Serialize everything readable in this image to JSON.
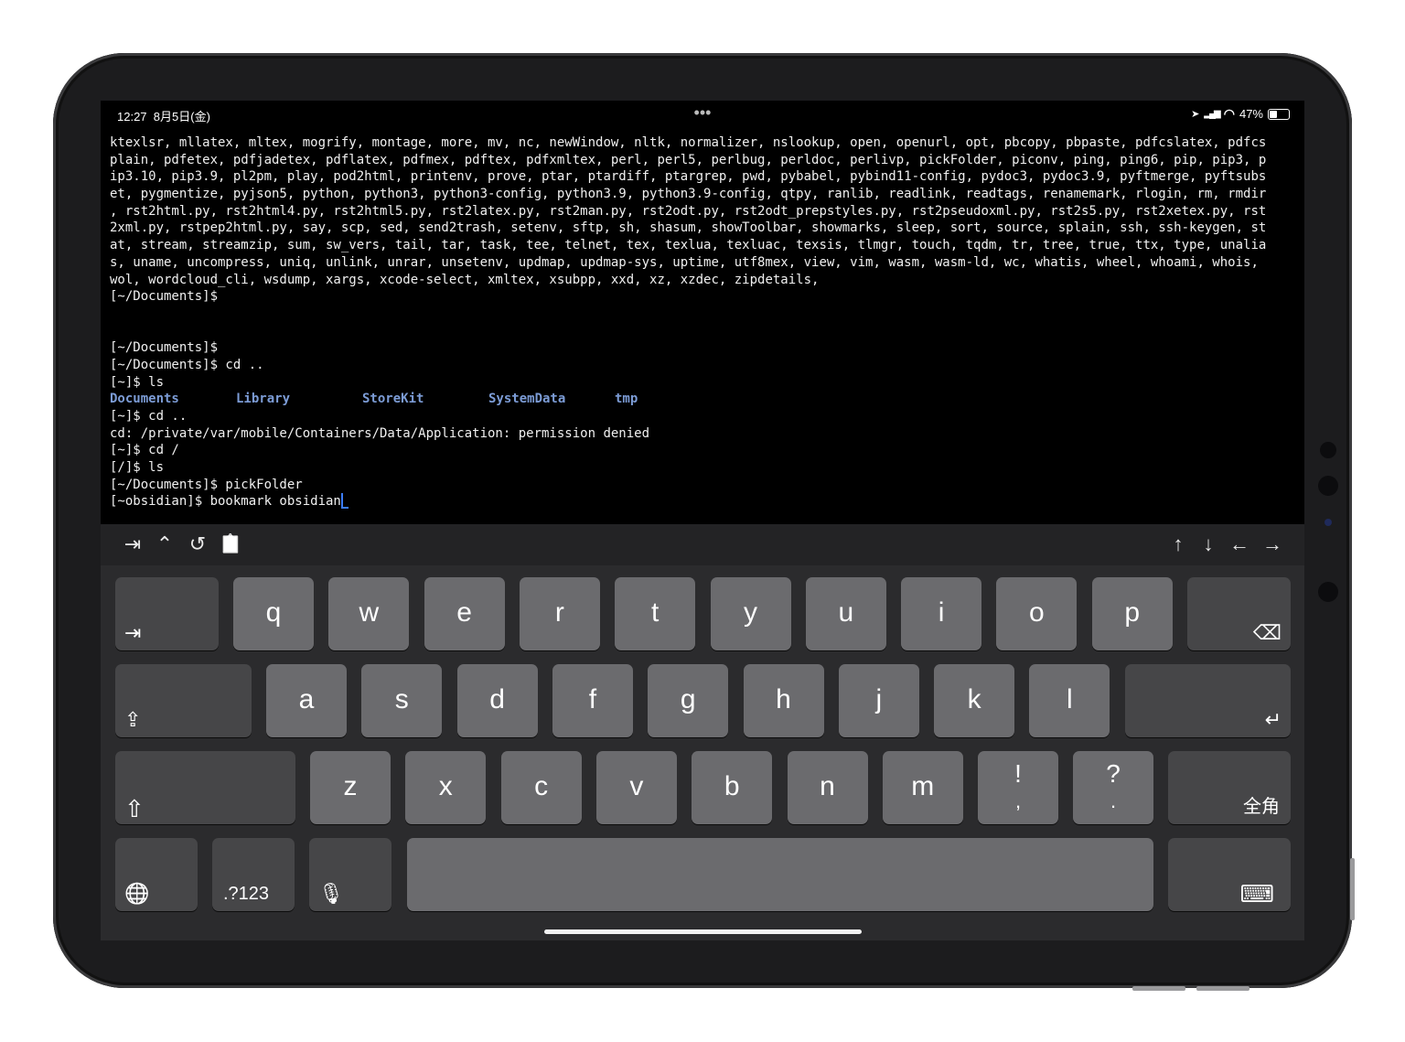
{
  "status_bar": {
    "time": "12:27",
    "date": "8月5日(金)",
    "dots": "•••",
    "location": "➤",
    "signal": "▂▄▆",
    "wifi": "◠",
    "battery": "47%"
  },
  "battery_level": 0.47,
  "terminal": {
    "lines": [
      "ktexlsr, mllatex, mltex, mogrify, montage, more, mv, nc, newWindow, nltk, normalizer, nslookup, open, openurl, opt, pbcopy, pbpaste, pdfcslatex, pdfcs",
      "plain, pdfetex, pdfjadetex, pdflatex, pdfmex, pdftex, pdfxmltex, perl, perl5, perlbug, perldoc, perlivp, pickFolder, piconv, ping, ping6, pip, pip3, p",
      "ip3.10, pip3.9, pl2pm, play, pod2html, printenv, prove, ptar, ptardiff, ptargrep, pwd, pybabel, pybind11-config, pydoc3, pydoc3.9, pyftmerge, pyftsubs",
      "et, pygmentize, pyjson5, python, python3, python3-config, python3.9, python3.9-config, qtpy, ranlib, readlink, readtags, renamemark, rlogin, rm, rmdir",
      ", rst2html.py, rst2html4.py, rst2html5.py, rst2latex.py, rst2man.py, rst2odt.py, rst2odt_prepstyles.py, rst2pseudoxml.py, rst2s5.py, rst2xetex.py, rst",
      "2xml.py, rstpep2html.py, say, scp, sed, send2trash, setenv, sftp, sh, shasum, showToolbar, showmarks, sleep, sort, source, splain, ssh, ssh-keygen, st",
      "at, stream, streamzip, sum, sw_vers, tail, tar, task, tee, telnet, tex, texlua, texluac, texsis, tlmgr, touch, tqdm, tr, tree, true, ttx, type, unalia",
      "s, uname, uncompress, uniq, unlink, unrar, unsetenv, updmap, updmap-sys, uptime, utf8mex, view, vim, wasm, wasm-ld, wc, whatis, wheel, whoami, whois,",
      "wol, wordcloud_cli, wsdump, xargs, xcode-select, xmltex, xsubpp, xxd, xz, xzdec, zipdetails,",
      "[~/Documents]$",
      "",
      "",
      "[~/Documents]$",
      "[~/Documents]$ cd ..",
      "[~]$ ls"
    ],
    "ls_dirs": [
      "Documents",
      "Library",
      "StoreKit",
      "SystemData",
      "tmp"
    ],
    "lines_after": [
      "[~]$ cd ..",
      "cd: /private/var/mobile/Containers/Data/Application: permission denied",
      "[~]$ cd /",
      "[/]$ ls",
      "[~/Documents]$ pickFolder"
    ],
    "current_line": "[~obsidian]$ bookmark obsidian"
  },
  "toolbar": {
    "left": [
      {
        "name": "tab-key-icon",
        "glyph": "⇥"
      },
      {
        "name": "control-key-icon",
        "glyph": "⌃"
      },
      {
        "name": "history-icon",
        "glyph": "↺"
      },
      {
        "name": "paste-icon",
        "glyph": "📋"
      }
    ],
    "right": [
      {
        "name": "arrow-up-icon",
        "glyph": "↑"
      },
      {
        "name": "arrow-down-icon",
        "glyph": "↓"
      },
      {
        "name": "arrow-left-icon",
        "glyph": "←"
      },
      {
        "name": "arrow-right-icon",
        "glyph": "→"
      }
    ]
  },
  "keyboard": {
    "row1": [
      "q",
      "w",
      "e",
      "r",
      "t",
      "y",
      "u",
      "i",
      "o",
      "p"
    ],
    "row2": [
      "a",
      "s",
      "d",
      "f",
      "g",
      "h",
      "j",
      "k",
      "l"
    ],
    "row3": [
      "z",
      "x",
      "c",
      "v",
      "b",
      "n",
      "m"
    ],
    "exclaim": {
      "top": "!",
      "bottom": ","
    },
    "question": {
      "top": "?",
      "bottom": "."
    },
    "tab_glyph": "⇥",
    "delete_glyph": "⌫",
    "caps_glyph": "⇪",
    "return_glyph": "↵",
    "shift_glyph": "⇧",
    "fullwidth_label": "全角",
    "globe_glyph": "🌐",
    "numbers_label": ".?123",
    "mic_glyph": "🎙",
    "hide_keyboard_glyph": "⌨"
  }
}
